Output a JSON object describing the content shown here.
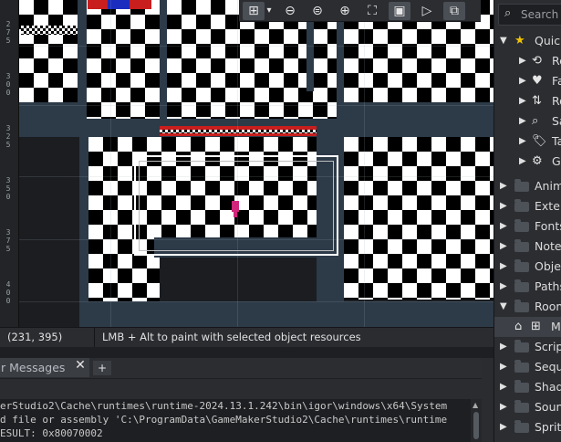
{
  "ruler": {
    "marks": [
      {
        "label": "2\n7\n5"
      },
      {
        "label": "3\n0\n0"
      },
      {
        "label": "3\n2\n5"
      },
      {
        "label": "3\n5\n0"
      },
      {
        "label": "3\n7\n5"
      },
      {
        "label": "4\n0\n0"
      }
    ]
  },
  "toolbar": {
    "buttons": [
      {
        "name": "grid-toggle",
        "icon": "grid-icon",
        "glyph": "⊞"
      },
      {
        "name": "grid-options",
        "icon": "chevron-down-icon",
        "glyph": "▾"
      },
      {
        "name": "zoom-out",
        "icon": "zoom-out-icon",
        "glyph": "⊖"
      },
      {
        "name": "zoom-reset",
        "icon": "zoom-reset-icon",
        "glyph": "⊜"
      },
      {
        "name": "zoom-in",
        "icon": "zoom-in-icon",
        "glyph": "⊕"
      },
      {
        "name": "fit-view",
        "icon": "fullscreen-icon",
        "glyph": "⛶"
      },
      {
        "name": "view-frame",
        "icon": "frame-icon",
        "glyph": "▣"
      },
      {
        "name": "play-room",
        "icon": "play-icon",
        "glyph": "▷"
      },
      {
        "name": "layers",
        "icon": "layers-icon",
        "glyph": "⧉"
      }
    ]
  },
  "status": {
    "coords": "(231, 395)",
    "hint": "LMB + Alt to paint with selected object resources"
  },
  "output": {
    "tab_label": "r Messages",
    "close_glyph": "✕",
    "add_tab_glyph": "+",
    "lines": [
      "erStudio2\\Cache\\runtimes\\runtime-2024.13.1.242\\bin\\igor\\windows\\x64\\System",
      "d file or assembly 'C:\\ProgramData\\GameMakerStudio2\\Cache\\runtimes\\runtime",
      "ESULT: 0x80070002"
    ]
  },
  "assets": {
    "search_placeholder": "Search",
    "items": [
      {
        "label": "Quick",
        "icon": "star-icon",
        "glyph": "★",
        "color": "#f2c400",
        "expanded": true,
        "depth": 0
      },
      {
        "label": "Re",
        "icon": "history-icon",
        "glyph": "⟲",
        "color": "#e6e6e6",
        "depth": 1
      },
      {
        "label": "Fa",
        "icon": "heart-icon",
        "glyph": "♥",
        "color": "#e6e6e6",
        "depth": 1
      },
      {
        "label": "Ro",
        "icon": "sort-icon",
        "glyph": "⇅",
        "color": "#e6e6e6",
        "depth": 1
      },
      {
        "label": "Sa",
        "icon": "search-icon",
        "glyph": "⌕",
        "color": "#e6e6e6",
        "depth": 1
      },
      {
        "label": "Ta",
        "icon": "tag-icon",
        "glyph": "🏷",
        "color": "#e6e6e6",
        "depth": 1
      },
      {
        "label": "Ga",
        "icon": "gear-icon",
        "glyph": "⚙",
        "color": "#e6e6e6",
        "depth": 1
      },
      {
        "label": "Anima",
        "icon": "folder-icon",
        "depth": 0
      },
      {
        "label": "Exten",
        "icon": "folder-icon",
        "depth": 0
      },
      {
        "label": "Fonts",
        "icon": "folder-icon",
        "depth": 0
      },
      {
        "label": "Notes",
        "icon": "folder-icon",
        "depth": 0
      },
      {
        "label": "Objec",
        "icon": "folder-icon",
        "depth": 0
      },
      {
        "label": "Paths",
        "icon": "folder-icon",
        "depth": 0
      },
      {
        "label": "Room",
        "icon": "folder-icon",
        "expanded": true,
        "depth": 0
      },
      {
        "label": "M",
        "icon": "room-icon",
        "glyph": "⌂",
        "color": "#e6e6e6",
        "depth": 1,
        "selected": true
      },
      {
        "label": "Script",
        "icon": "folder-icon",
        "depth": 0
      },
      {
        "label": "Seque",
        "icon": "folder-icon",
        "depth": 0
      },
      {
        "label": "Shade",
        "icon": "folder-icon",
        "depth": 0
      },
      {
        "label": "Sound",
        "icon": "folder-icon",
        "depth": 0
      },
      {
        "label": "Sprite",
        "icon": "folder-icon",
        "depth": 0
      }
    ]
  },
  "colors": {
    "wall": "#2d3a48",
    "selection_border": "#ffffff",
    "player": "#d0257a",
    "red_strip": "#c81e1e",
    "blue_strip": "#1b2dbf"
  }
}
